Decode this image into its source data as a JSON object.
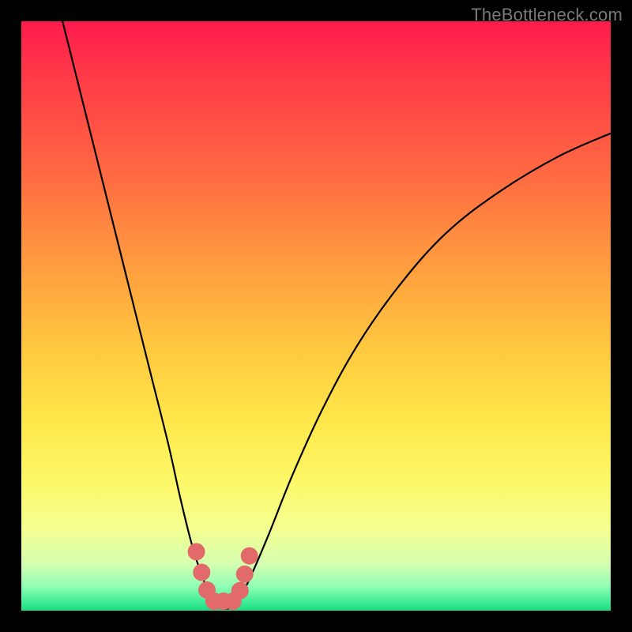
{
  "watermark": "TheBottleneck.com",
  "chart_data": {
    "type": "line",
    "title": "",
    "xlabel": "",
    "ylabel": "",
    "xlim": [
      0,
      100
    ],
    "ylim": [
      0,
      100
    ],
    "series": [
      {
        "name": "bottleneck-curve",
        "x": [
          7,
          10,
          13,
          16,
          19,
          22,
          25,
          27,
          29,
          31,
          32.5,
          34,
          35.5,
          37,
          39,
          42,
          46,
          51,
          57,
          64,
          72,
          81,
          91,
          100
        ],
        "y": [
          100,
          88,
          76,
          64,
          52,
          40,
          28,
          19,
          11,
          5,
          2,
          0.5,
          0.5,
          2,
          6,
          13,
          23,
          34,
          45,
          55,
          64,
          71,
          77,
          81
        ]
      }
    ],
    "markers": [
      {
        "x": 29.7,
        "y": 10.0
      },
      {
        "x": 30.6,
        "y": 6.5
      },
      {
        "x": 31.5,
        "y": 3.5
      },
      {
        "x": 32.7,
        "y": 1.6
      },
      {
        "x": 34.3,
        "y": 1.6
      },
      {
        "x": 35.9,
        "y": 1.6
      },
      {
        "x": 37.1,
        "y": 3.4
      },
      {
        "x": 37.9,
        "y": 6.2
      },
      {
        "x": 38.7,
        "y": 9.3
      }
    ],
    "marker_color": "#e26a6a",
    "gradient_top": "#ff1a4d",
    "gradient_bottom": "#1fd986"
  }
}
